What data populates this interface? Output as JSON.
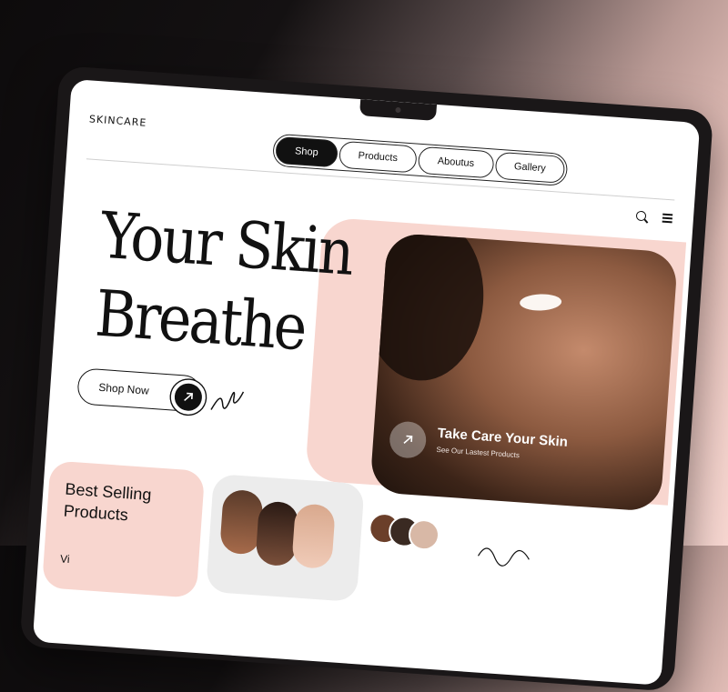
{
  "brand": {
    "logo": "SKINCARE"
  },
  "nav": {
    "items": [
      "Shop",
      "Products",
      "Aboutus",
      "Gallery"
    ],
    "active": "Shop"
  },
  "hero": {
    "title_line1": "Your Skin",
    "title_line2": "Breathe",
    "cta_label": "Shop Now"
  },
  "feature": {
    "title": "Take Care Your Skin",
    "subtitle": "See Our Lastest Products"
  },
  "cards": {
    "best_selling_title": "Best Selling Products",
    "best_selling_link": "Vi"
  },
  "icons": [
    "search-icon",
    "menu-icon",
    "arrow-up-right-icon",
    "squiggle-icon"
  ],
  "colors": {
    "accent_pink": "#f8d6cf",
    "dark": "#111111"
  }
}
